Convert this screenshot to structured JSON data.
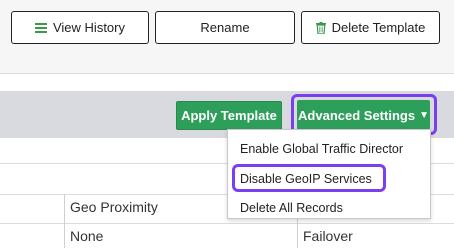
{
  "toolbar": {
    "view_history_label": "View History",
    "rename_label": "Rename",
    "delete_label": "Delete Template",
    "view_history_icon": "list-icon",
    "delete_icon": "trash-icon"
  },
  "actions": {
    "apply_label": "Apply Template",
    "advanced_label": "Advanced Settings",
    "advanced_icon": "caret-down-icon"
  },
  "dropdown": {
    "items": [
      {
        "label": "Enable Global Traffic Director"
      },
      {
        "label": "Disable GeoIP Services"
      },
      {
        "label": "Delete All Records"
      }
    ]
  },
  "table": {
    "headers": [
      "Geo Proximity"
    ],
    "row": [
      "None",
      "Failover"
    ]
  },
  "colors": {
    "accent_green": "#2e9e5b",
    "highlight_purple": "#7b3ff2"
  }
}
